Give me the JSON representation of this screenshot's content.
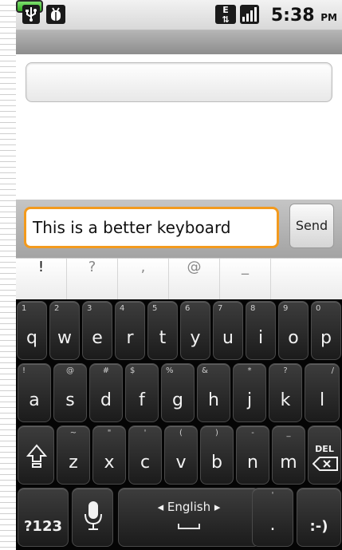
{
  "status_bar": {
    "network_type": "E",
    "time": "5:38",
    "time_suffix": "PM",
    "icons": [
      "usb-icon",
      "debug-icon",
      "edge-network-icon",
      "signal-icon",
      "battery-icon"
    ]
  },
  "compose": {
    "message_value": "This is a better keyboard",
    "send_label": "Send"
  },
  "suggestions": [
    "!",
    "?",
    ",",
    "@",
    "_"
  ],
  "keyboard": {
    "row1": [
      {
        "key": "q",
        "hint": "1"
      },
      {
        "key": "w",
        "hint": "2"
      },
      {
        "key": "e",
        "hint": "3"
      },
      {
        "key": "r",
        "hint": "4"
      },
      {
        "key": "t",
        "hint": "5"
      },
      {
        "key": "y",
        "hint": "6"
      },
      {
        "key": "u",
        "hint": "7"
      },
      {
        "key": "i",
        "hint": "8"
      },
      {
        "key": "o",
        "hint": "9"
      },
      {
        "key": "p",
        "hint": "0"
      }
    ],
    "row2": [
      {
        "key": "a",
        "hint": "!"
      },
      {
        "key": "s",
        "hint": "@"
      },
      {
        "key": "d",
        "hint": "#"
      },
      {
        "key": "f",
        "hint": "$"
      },
      {
        "key": "g",
        "hint": "%"
      },
      {
        "key": "h",
        "hint": "&"
      },
      {
        "key": "j",
        "hint": "*"
      },
      {
        "key": "k",
        "hint": "?"
      },
      {
        "key": "l",
        "hint": "/"
      }
    ],
    "row3": [
      {
        "key": "z",
        "hint": "~"
      },
      {
        "key": "x",
        "hint": "\""
      },
      {
        "key": "c",
        "hint": "'"
      },
      {
        "key": "v",
        "hint": "("
      },
      {
        "key": "b",
        "hint": ")"
      },
      {
        "key": "n",
        "hint": "-"
      },
      {
        "key": "m",
        "hint": "_"
      }
    ],
    "del_label": "DEL",
    "symbols_label": "?123",
    "language_label": "◂ English ▸",
    "period_key": ".",
    "period_hint": "'",
    "smiley_key": ":-)"
  },
  "colors": {
    "input_focus": "#f39a1d",
    "battery": "#2fa81f",
    "keyboard_bg": "#050505"
  }
}
